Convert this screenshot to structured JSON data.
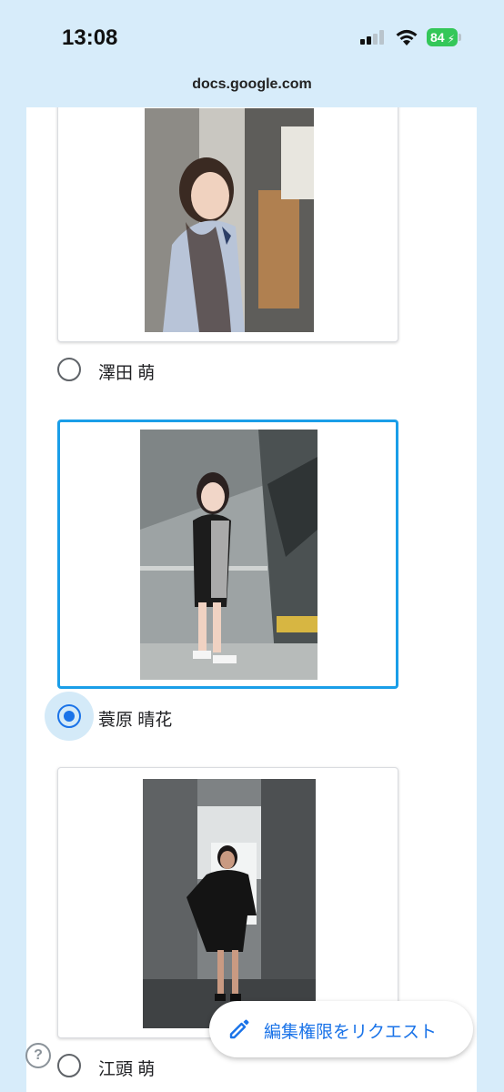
{
  "status_bar": {
    "time": "13:08",
    "battery": "84",
    "signal_icon": "cellular-signal-icon",
    "wifi_icon": "wifi-icon",
    "battery_color": "#34c759"
  },
  "browser": {
    "url": "docs.google.com"
  },
  "form": {
    "accent_color": "#1a73e8",
    "options": [
      {
        "label": "澤田 萌",
        "selected": false,
        "photo": "portrait-girl-white-shirt"
      },
      {
        "label": "蓑原 晴花",
        "selected": true,
        "photo": "portrait-girl-black-dress-wall"
      },
      {
        "label": "江頭 萌",
        "selected": false,
        "photo": "portrait-girl-polka-dot-dress"
      }
    ]
  },
  "request_button": {
    "label": "編集権限をリクエスト",
    "icon": "pencil-icon"
  },
  "help_icon": {
    "glyph": "?"
  }
}
